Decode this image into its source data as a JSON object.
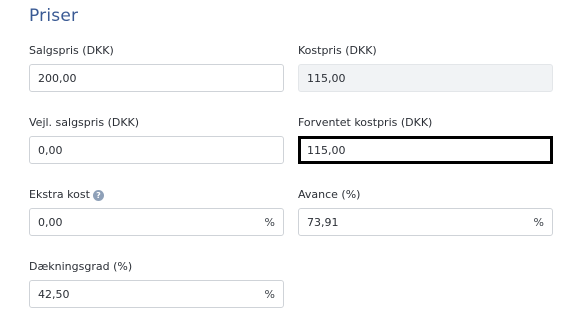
{
  "section": {
    "title": "Priser"
  },
  "fields": {
    "salgspris": {
      "label": "Salgspris (DKK)",
      "value": "200,00"
    },
    "kostpris": {
      "label": "Kostpris (DKK)",
      "value": "115,00"
    },
    "vejl_salgspris": {
      "label": "Vejl. salgspris (DKK)",
      "value": "0,00"
    },
    "forventet_kostpris": {
      "label": "Forventet kostpris (DKK)",
      "value": "115,00"
    },
    "ekstra_kost": {
      "label": "Ekstra kost",
      "value": "0,00",
      "suffix": "%",
      "info_icon": "question-icon"
    },
    "avance": {
      "label": "Avance (%)",
      "value": "73,91",
      "suffix": "%"
    },
    "daekningsgrad": {
      "label": "Dækningsgrad (%)",
      "value": "42,50",
      "suffix": "%"
    }
  }
}
